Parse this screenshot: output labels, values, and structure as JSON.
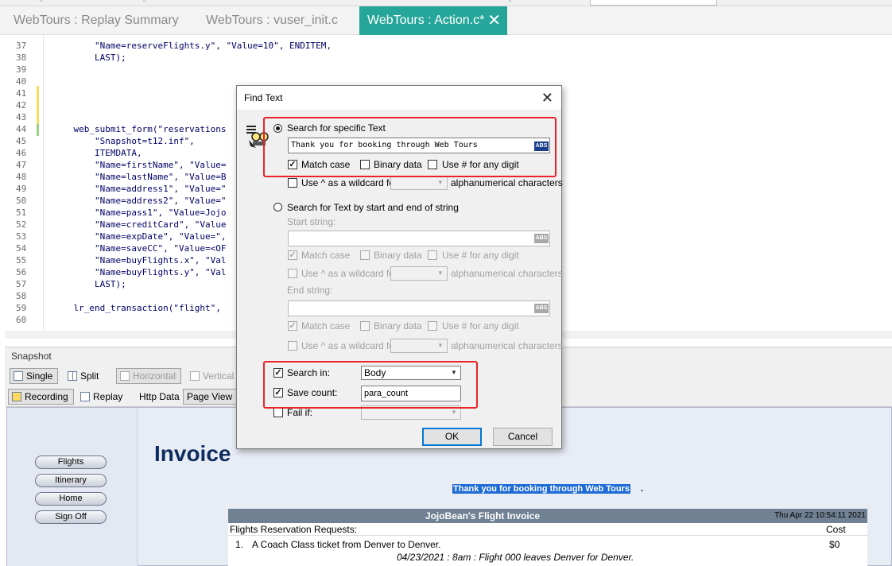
{
  "tabs": [
    {
      "label": "WebTours : Replay Summary"
    },
    {
      "label": "WebTours : vuser_init.c"
    },
    {
      "label": "WebTours : Action.c*",
      "active": true
    }
  ],
  "editor": {
    "line_numbers": [
      "37",
      "38",
      "39",
      "40",
      "41",
      "42",
      "43",
      "44",
      "45",
      "46",
      "47",
      "48",
      "49",
      "50",
      "51",
      "52",
      "53",
      "54",
      "55",
      "56",
      "57",
      "58",
      "59",
      "60"
    ],
    "lines": [
      "        \"Name=reserveFlights.y\", \"Value=10\", ENDITEM,",
      "        LAST);",
      "",
      "",
      "",
      "",
      "",
      "    web_submit_form(\"reservations",
      "        \"Snapshot=t12.inf\",",
      "        ITEMDATA,",
      "        \"Name=firstName\", \"Value=",
      "        \"Name=lastName\", \"Value=B",
      "        \"Name=address1\", \"Value=\"",
      "        \"Name=address2\", \"Value=\"",
      "        \"Name=pass1\", \"Value=Jojo",
      "        \"Name=creditCard\", \"Value",
      "        \"Name=expDate\", \"Value=\",",
      "        \"Name=saveCC\", \"Value=<OF",
      "        \"Name=buyFlights.x\", \"Val",
      "        \"Name=buyFlights.y\", \"Val",
      "        LAST);",
      "",
      "    lr_end_transaction(\"flight\",",
      ""
    ]
  },
  "snapshot": {
    "header": "Snapshot",
    "single": "Single",
    "split": "Split",
    "horizontal": "Horizontal",
    "vertical": "Vertical",
    "recording": "Recording",
    "replay": "Replay",
    "http_data": "Http Data",
    "page_view": "Page View"
  },
  "page": {
    "nav": [
      "Flights",
      "Itinerary",
      "Home",
      "Sign Off"
    ],
    "invoice_title": "Invoice",
    "thanks": "Thank you for booking through Web Tours",
    "thanks_suffix": ".",
    "invoice_header": "JojoBean's Flight Invoice",
    "invoice_date": "Thu Apr 22 10:54:11 2021",
    "requests_label": "Flights Reservation Requests:",
    "cost_label": "Cost",
    "item_number": "1.",
    "item_text": "A Coach Class ticket from Denver to Denver.",
    "item_cost": "$0",
    "item_detail": "04/23/2021 : 8am : Flight 000 leaves Denver for Denver."
  },
  "dialog": {
    "title": "Find Text",
    "close": "✕",
    "search_specific": "Search for specific Text",
    "search_value": "Thank you for booking through Web Tours",
    "abs": "ABS",
    "match_case": "Match case",
    "binary_data": "Binary data",
    "use_hash": "Use # for any digit",
    "use_caret": "Use ^ as a wildcard for",
    "alnum": "alphanumerical characters",
    "search_by_string": "Search for Text by start and end of string",
    "start_string": "Start string:",
    "end_string": "End string:",
    "search_in": "Search in:",
    "search_in_value": "Body",
    "save_count": "Save count:",
    "save_count_value": "para_count",
    "fail_if": "Fail if:",
    "ok": "OK",
    "cancel": "Cancel"
  },
  "colors": {
    "active_tab": "#26a69a",
    "highlight": "#e8242a",
    "code_text": "#000066",
    "selection": "#1e6bd6"
  }
}
